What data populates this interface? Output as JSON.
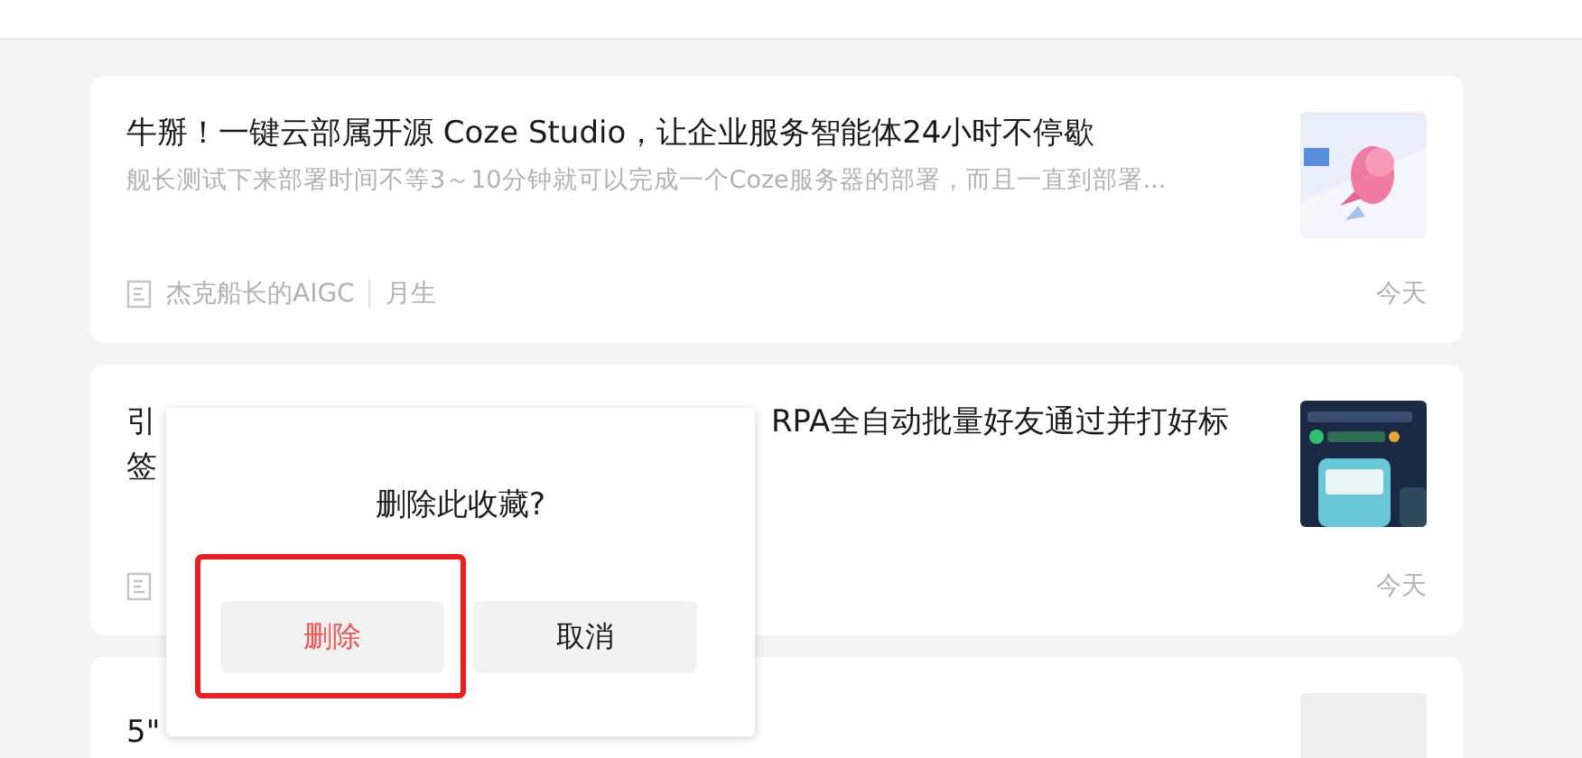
{
  "articles": [
    {
      "kind": "full",
      "title": "牛掰！一键云部属开源 Coze Studio，让企业服务智能体24小时不停歇",
      "excerpt": "舰长测试下来部署时间不等3～10分钟就可以完成一个Coze服务器的部署，而且一直到部署...",
      "author": "杰克船长的AIGC",
      "tag": "月生",
      "date": "今天"
    },
    {
      "kind": "covered",
      "title_parts": [
        "引",
        "RPA全自动批量好友通过并打好标",
        "签"
      ],
      "date": "今天"
    },
    {
      "kind": "cut",
      "title": "5\""
    }
  ],
  "dialog": {
    "message": "删除此收藏?",
    "buttons": [
      {
        "label": "删除",
        "kind": "danger",
        "highlighted": true
      },
      {
        "label": "取消",
        "kind": "normal",
        "highlighted": false
      }
    ]
  }
}
